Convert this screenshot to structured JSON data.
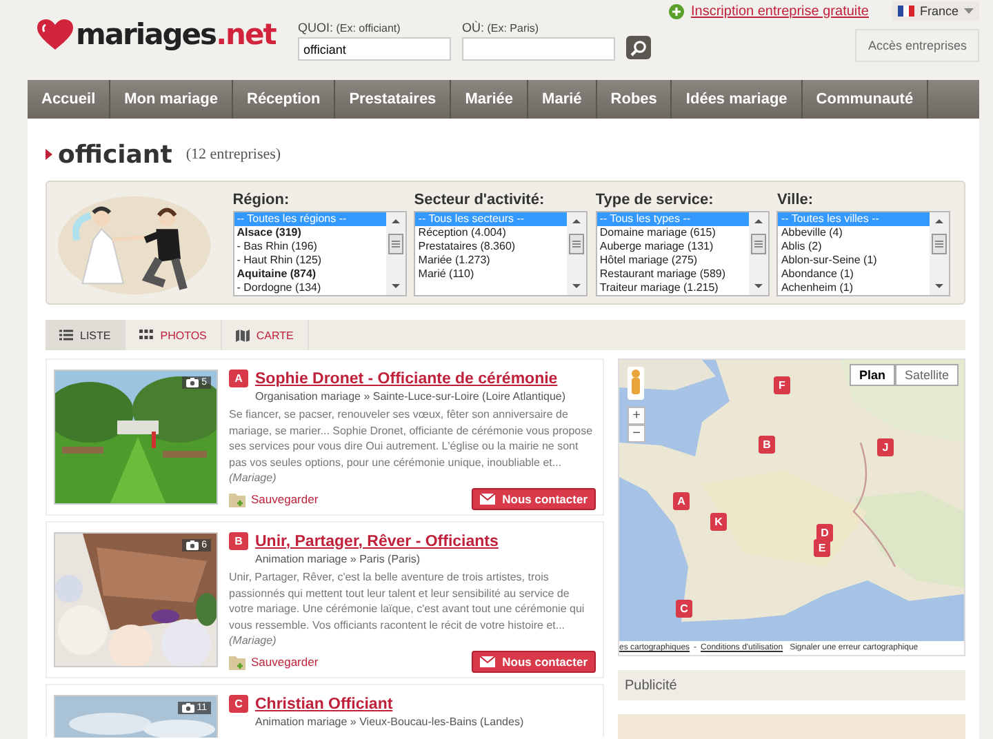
{
  "header": {
    "logo": {
      "brand": "mariages",
      "tld": ".net"
    },
    "search": {
      "what_label": "QUOI:",
      "what_hint": "(Ex: officiant)",
      "what_value": "officiant",
      "where_label": "OÙ:",
      "where_hint": "(Ex: Paris)"
    },
    "signup_link": "Inscription entreprise gratuite",
    "language": "France",
    "business_button": "Accès entreprises"
  },
  "nav": [
    "Accueil",
    "Mon mariage",
    "Réception",
    "Prestataires",
    "Mariée",
    "Marié",
    "Robes",
    "Idées mariage",
    "Communauté"
  ],
  "heading": {
    "title": "officiant",
    "count": "(12 entreprises)"
  },
  "filters": [
    {
      "label": "Région:",
      "options": [
        {
          "text": "-- Toutes les régions --",
          "selected": true,
          "kind": "item"
        },
        {
          "text": "Alsace (319)",
          "selected": false,
          "kind": "group"
        },
        {
          "text": "- Bas Rhin (196)",
          "selected": false,
          "kind": "item"
        },
        {
          "text": "- Haut Rhin (125)",
          "selected": false,
          "kind": "item"
        },
        {
          "text": "Aquitaine (874)",
          "selected": false,
          "kind": "group"
        },
        {
          "text": "- Dordogne (134)",
          "selected": false,
          "kind": "item"
        }
      ]
    },
    {
      "label": "Secteur d'activité:",
      "options": [
        {
          "text": "-- Tous les secteurs --",
          "selected": true,
          "kind": "item"
        },
        {
          "text": "Réception (4.004)",
          "selected": false,
          "kind": "item"
        },
        {
          "text": "Prestataires (8.360)",
          "selected": false,
          "kind": "item"
        },
        {
          "text": "Mariée (1.273)",
          "selected": false,
          "kind": "item"
        },
        {
          "text": "Marié (110)",
          "selected": false,
          "kind": "item"
        }
      ]
    },
    {
      "label": "Type de service:",
      "options": [
        {
          "text": "-- Tous les types --",
          "selected": true,
          "kind": "item"
        },
        {
          "text": "Domaine mariage (615)",
          "selected": false,
          "kind": "item"
        },
        {
          "text": "Auberge mariage (131)",
          "selected": false,
          "kind": "item"
        },
        {
          "text": "Hôtel mariage (275)",
          "selected": false,
          "kind": "item"
        },
        {
          "text": "Restaurant mariage (589)",
          "selected": false,
          "kind": "item"
        },
        {
          "text": "Traiteur mariage (1.215)",
          "selected": false,
          "kind": "item"
        }
      ]
    },
    {
      "label": "Ville:",
      "options": [
        {
          "text": "-- Toutes les villes --",
          "selected": true,
          "kind": "item"
        },
        {
          "text": "Abbeville (4)",
          "selected": false,
          "kind": "item"
        },
        {
          "text": "Ablis (2)",
          "selected": false,
          "kind": "item"
        },
        {
          "text": "Ablon-sur-Seine (1)",
          "selected": false,
          "kind": "item"
        },
        {
          "text": "Abondance (1)",
          "selected": false,
          "kind": "item"
        },
        {
          "text": "Achenheim (1)",
          "selected": false,
          "kind": "item"
        }
      ]
    }
  ],
  "view_tabs": [
    {
      "label": "LISTE",
      "kind": "list",
      "selected": true
    },
    {
      "label": "PHOTOS",
      "kind": "photos",
      "selected": false
    },
    {
      "label": "CARTE",
      "kind": "map",
      "selected": false
    }
  ],
  "listings": [
    {
      "marker": "A",
      "title": "Sophie Dronet - Officiante de cérémonie",
      "subtitle": "Organisation mariage » Sainte-Luce-sur-Loire (Loire Atlantique)",
      "photo_count": "5",
      "description": "Se fiancer, se pacser, renouveler ses vœux, fêter son anniversaire de mariage, se marier... Sophie Dronet, officiante de cérémonie vous propose ses services pour vous dire Oui autrement. L'église ou la mairie ne sont pas vos seules options, pour une cérémonie unique, inoubliable et...",
      "tag": "(Mariage)",
      "save": "Sauvegarder",
      "contact": "Nous contacter"
    },
    {
      "marker": "B",
      "title": "Unir, Partager, Rêver - Officiants",
      "subtitle": "Animation mariage » Paris (Paris)",
      "photo_count": "6",
      "description": "Unir, Partager, Rêver, c'est la belle aventure de trois artistes, trois passionnés qui mettent tout leur talent et leur sensibilité au service de votre mariage. Une cérémonie laïque, c'est avant tout une cérémonie qui vous ressemble. Vos officiants racontent le récit de votre histoire et...",
      "tag": "(Mariage)",
      "save": "Sauvegarder",
      "contact": "Nous contacter"
    },
    {
      "marker": "C",
      "title": "Christian Officiant",
      "subtitle": "Animation mariage » Vieux-Boucau-les-Bains (Landes)",
      "photo_count": "11"
    }
  ],
  "map": {
    "markers": [
      {
        "letter": "F"
      },
      {
        "letter": "B"
      },
      {
        "letter": "J"
      },
      {
        "letter": "A"
      },
      {
        "letter": "K"
      },
      {
        "letter": "D"
      },
      {
        "letter": "E"
      },
      {
        "letter": "C"
      }
    ],
    "map_types": [
      {
        "label": "Plan",
        "selected": true
      },
      {
        "label": "Satellite",
        "selected": false
      }
    ],
    "zoom_in": "+",
    "zoom_out": "−",
    "attribution_links": [
      "es cartographiques",
      "Conditions d'utilisation"
    ],
    "attribution_separator": "-",
    "report_link": "Signaler une erreur cartographique"
  },
  "ad": {
    "title": "Publicité"
  }
}
